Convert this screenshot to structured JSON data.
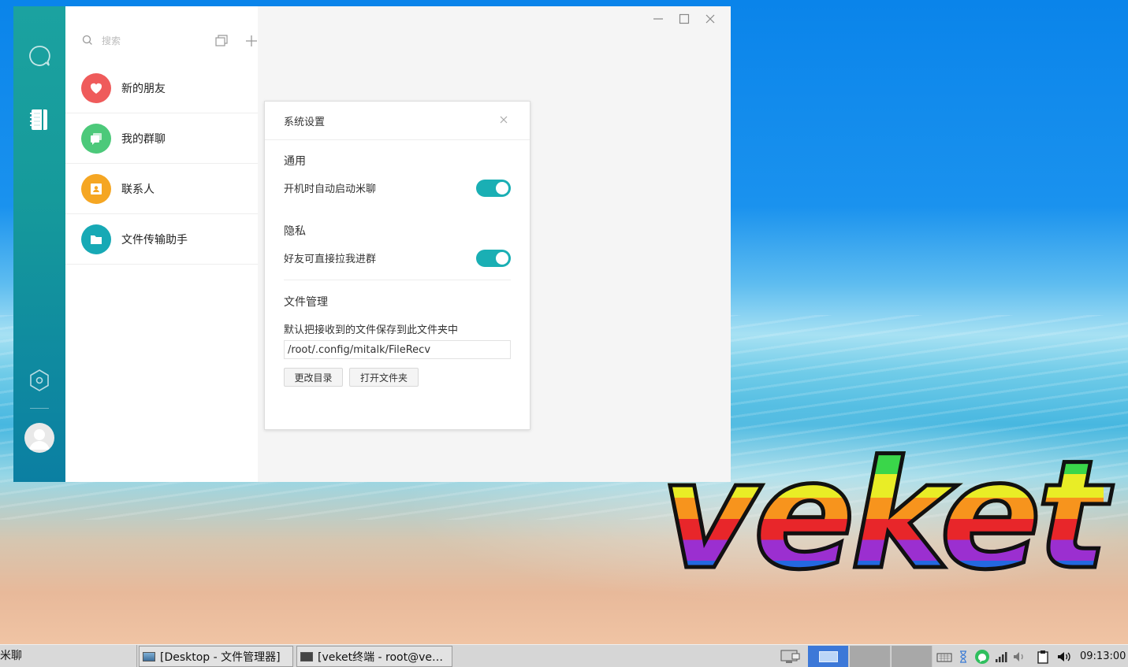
{
  "desktop": {
    "logo_text": "veket"
  },
  "app": {
    "search": {
      "placeholder": "搜索"
    },
    "contacts": [
      {
        "label": "新的朋友",
        "icon": "heart-icon",
        "color": "#ef5b5b"
      },
      {
        "label": "我的群聊",
        "icon": "group-chat-icon",
        "color": "#4cc97a"
      },
      {
        "label": "联系人",
        "icon": "contact-card-icon",
        "color": "#f5a623"
      },
      {
        "label": "文件传输助手",
        "icon": "folder-icon",
        "color": "#17a9b5"
      }
    ],
    "accent_color": "#1aafb4"
  },
  "settings": {
    "title": "系统设置",
    "general": {
      "heading": "通用",
      "autostart_label": "开机时自动启动米聊",
      "autostart_enabled": true
    },
    "privacy": {
      "heading": "隐私",
      "allow_group_invite_label": "好友可直接拉我进群",
      "allow_group_invite_enabled": true
    },
    "files": {
      "heading": "文件管理",
      "description": "默认把接收到的文件保存到此文件夹中",
      "path_value": "/root/.config/mitalk/FileRecv",
      "change_dir_label": "更改目录",
      "open_folder_label": "打开文件夹"
    }
  },
  "taskbar": {
    "start_label": "米聊",
    "tasks": [
      {
        "label": "[Desktop - 文件管理器]"
      },
      {
        "label": "[veket终端 - root@ve…"
      }
    ],
    "clock": "09:13:00"
  }
}
